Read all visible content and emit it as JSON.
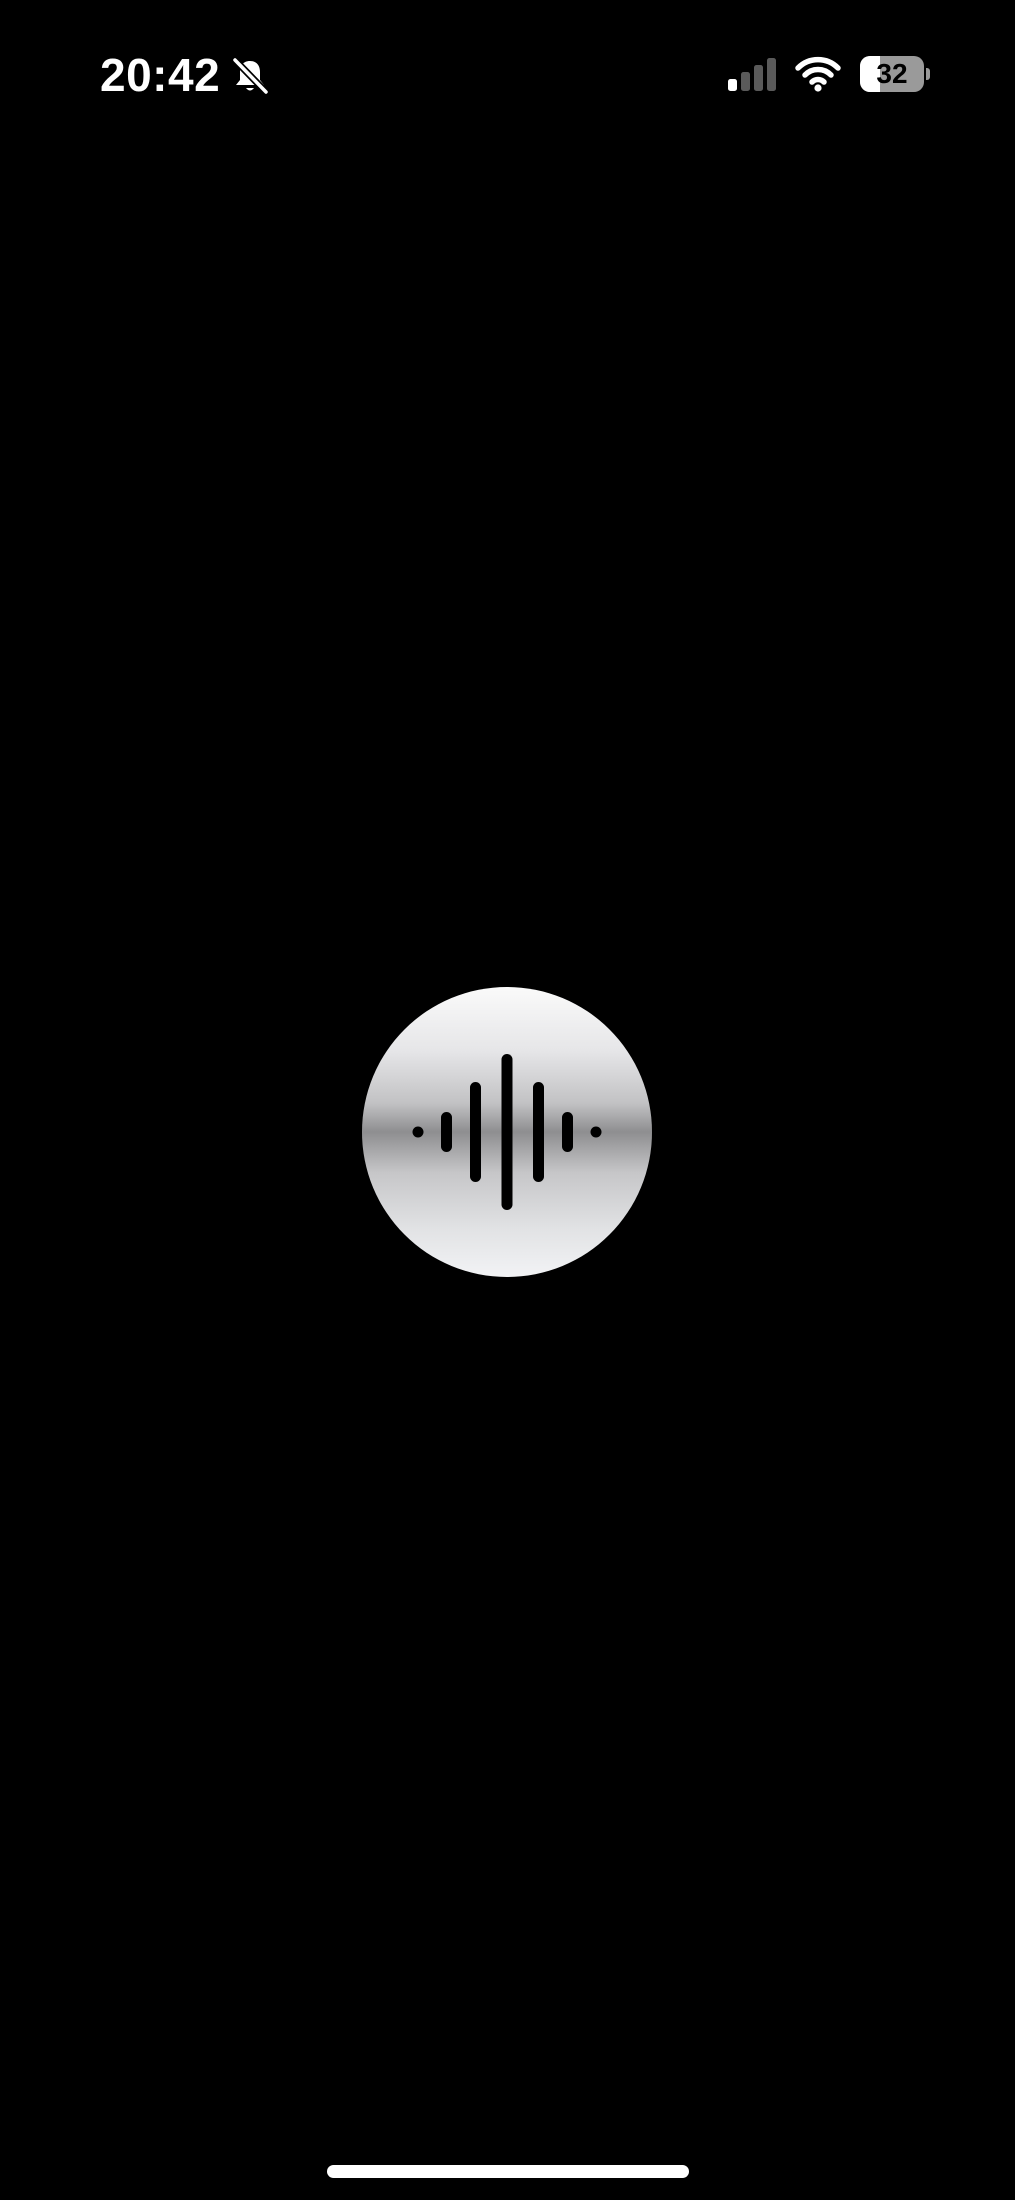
{
  "status_bar": {
    "time": "20:42",
    "silent_icon": "bell-slash-icon",
    "signal_icon": "cellular-signal-icon",
    "signal_bars_active": 1,
    "signal_bars_total": 4,
    "wifi_icon": "wifi-icon",
    "battery_level": "32",
    "battery_fraction": 0.32
  },
  "voice_button": {
    "icon": "sound-waveform-icon"
  },
  "colors": {
    "background": "#000000",
    "foreground": "#ffffff",
    "orb_highlight": "#f2f3f5",
    "orb_shadow": "#8e8e90",
    "waveform": "#000000"
  }
}
